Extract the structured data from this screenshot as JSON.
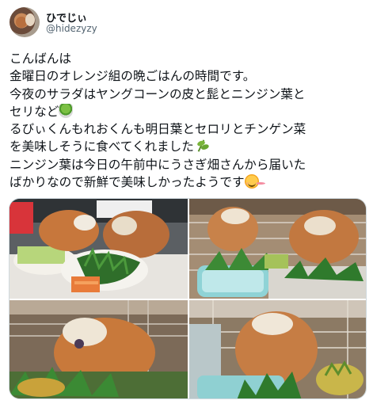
{
  "user": {
    "display_name": "ひでじぃ",
    "handle": "@hidezyzy"
  },
  "tweet": {
    "lines": [
      "こんばんは",
      "金曜日のオレンジ組の晩ごはんの時間です。",
      "今夜のサラダはヤングコーンの皮と髭とニンジン葉と",
      "セリなど",
      "るびぃくんもれおくんも明日葉とセロリとチンゲン菜",
      "を美味しそうに食べてくれました",
      "ニンジン葉は今日の午前中にうさぎ畑さんから届いた",
      "ばかりなので新鮮で美味しかったようです"
    ],
    "emojis": {
      "line4": "salad-emoji",
      "line6": "herb-emoji",
      "line8": "smiling-face-emoji"
    }
  },
  "media": {
    "photos": [
      {
        "subject": "two guinea pigs beside plates of salad"
      },
      {
        "subject": "guinea pigs eating greens in cage"
      },
      {
        "subject": "guinea pig close-up with greens"
      },
      {
        "subject": "guinea pig eating leaves"
      }
    ]
  },
  "colors": {
    "text": "#0f1419",
    "secondary": "#536471",
    "border": "#cfd9de"
  }
}
